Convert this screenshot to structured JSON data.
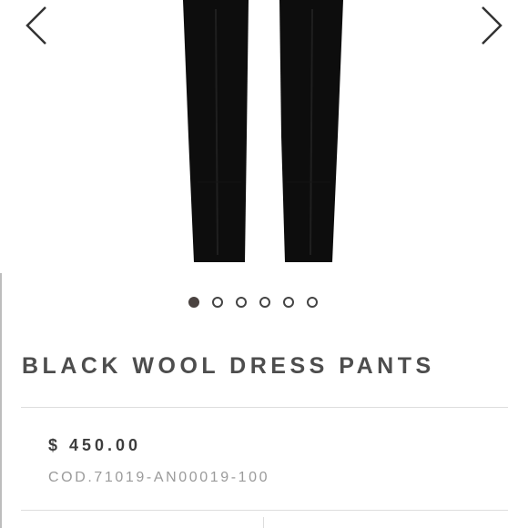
{
  "gallery": {
    "image_name": "black-wool-dress-pants-image",
    "active_index": 0,
    "dot_count": 6,
    "prev_icon": "chevron-left-icon",
    "next_icon": "chevron-right-icon"
  },
  "product": {
    "title": "BLACK WOOL DRESS PANTS",
    "price": "$ 450.00",
    "code": "COD.71019-AN00019-100"
  },
  "colors": {
    "title": "#4d4d4d",
    "price": "#3d3d3d",
    "code": "#9a9a9a",
    "dot_active": "#4a4340"
  }
}
